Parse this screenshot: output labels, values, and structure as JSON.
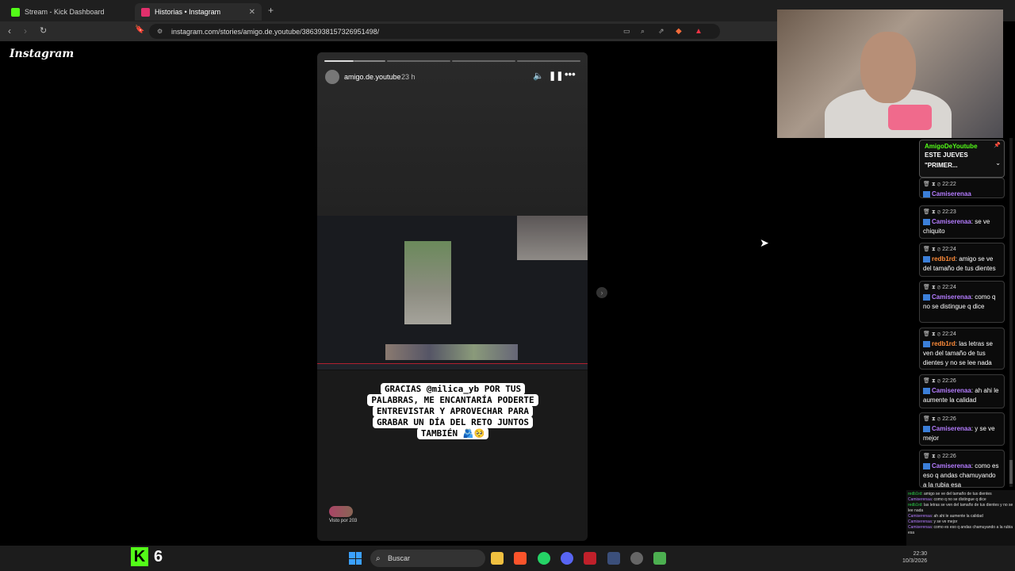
{
  "tabs": [
    {
      "title": "Stream - Kick Dashboard",
      "favicon_color": "#53fc18"
    },
    {
      "title": "Historias • Instagram",
      "favicon_color": "#e1306c"
    }
  ],
  "new_tab": "+",
  "url": "instagram.com/stories/amigo.de.youtube/3863938157326951498/",
  "instagram_logo": "Instagram",
  "story": {
    "username": "amigo.de.youtube",
    "time": "23 h",
    "caption": "GRACIAS @milica_yb POR TUS PALABRAS, ME ENCANTARÍA PODERTE ENTREVISTAR Y APROVECHAR PARA GRABAR UN DÍA DEL RETO JUNTOS TAMBIÉN 🫂🥺",
    "viewers": "Visto por 203",
    "progress_segments": 4,
    "progress_current": 1
  },
  "chat": {
    "pinned_user": "AmigoDeYoutube",
    "pinned_text": "ESTE JUEVES \"PRIMER...",
    "messages": [
      {
        "time": "22:22",
        "user": "Camiserenaa",
        "text": ""
      },
      {
        "time": "22:23",
        "user": "Camiserenaa",
        "text": ": se ve chiquito"
      },
      {
        "time": "22:24",
        "user": "redb1rd",
        "text": ": amigo se ve del tamaño de tus dientes"
      },
      {
        "time": "22:24",
        "user": "Camiserenaa",
        "text": ": como q no se distingue q dice"
      },
      {
        "time": "22:24",
        "user": "redb1rd",
        "text": ": las letras se ven del tamaño de tus dientes y no se lee nada"
      },
      {
        "time": "22:26",
        "user": "Camiserenaa",
        "text": ": ah ahi le aumente la calidad"
      },
      {
        "time": "22:26",
        "user": "Camiserenaa",
        "text": ": y se ve mejor"
      },
      {
        "time": "22:26",
        "user": "Camiserenaa",
        "text": ": como es eso q andas chamuyando a la rubia esa"
      }
    ]
  },
  "overlay_chat": [
    {
      "user": "redb1rd",
      "text": ": amigo se ve del tamaño de tus dientes"
    },
    {
      "user": "Camiserenaa",
      "text": ": como q no se distingue q dice"
    },
    {
      "user": "redb1rd",
      "text": ": las letras se ven del tamaño de tus dientes y no se lee nada"
    },
    {
      "user": "Camiserenaa",
      "text": ": ah ahi le aumente la calidad"
    },
    {
      "user": "Camiserenaa",
      "text": ": y se ve mejor"
    },
    {
      "user": "Camiserenaa",
      "text": ": como es eso q andas chamuyando a la rubia esa"
    }
  ],
  "kick": {
    "logo": "K",
    "count": "6"
  },
  "taskbar": {
    "search_label": "Buscar",
    "time": "22:30",
    "date": "10/3/2026"
  }
}
